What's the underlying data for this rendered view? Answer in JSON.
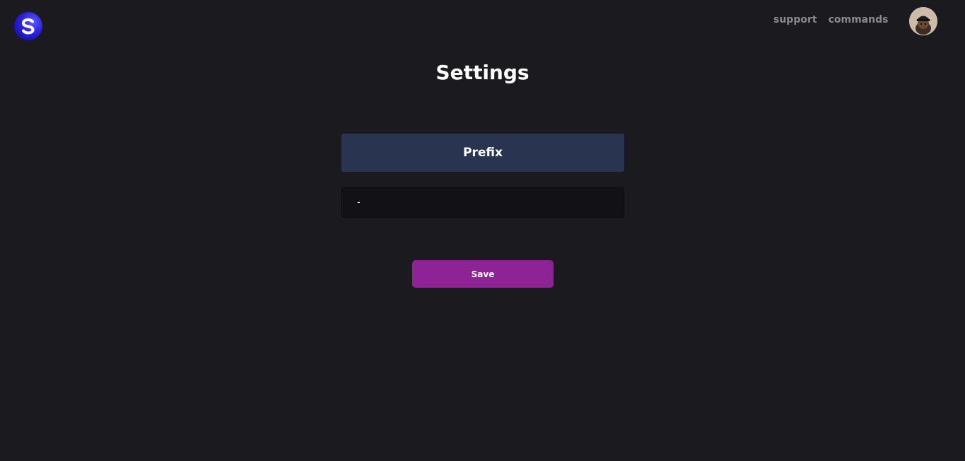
{
  "header": {
    "logo_icon": "s-logo-icon",
    "nav": {
      "support_label": "support",
      "commands_label": "commands"
    },
    "avatar_icon": "user-avatar"
  },
  "main": {
    "title": "Settings",
    "prefix_section": {
      "label": "Prefix",
      "input_value": "-"
    },
    "save_label": "Save"
  },
  "colors": {
    "background": "#1a1a1f",
    "section_header": "#293550",
    "input_bg": "#121216",
    "save_button": "#8e2396",
    "nav_text": "#8a8a92",
    "logo_blue": "#2a1fe0"
  }
}
